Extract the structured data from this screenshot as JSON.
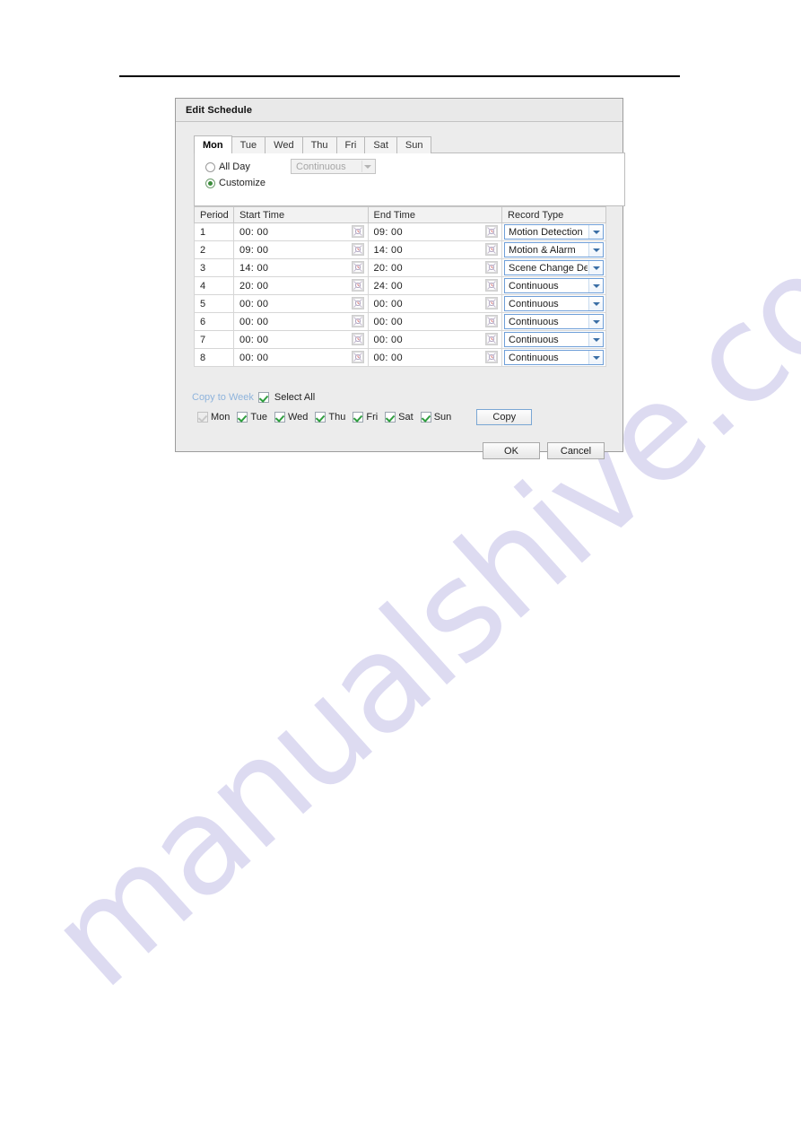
{
  "dialog": {
    "title": "Edit Schedule",
    "ok_label": "OK",
    "cancel_label": "Cancel"
  },
  "tabs": [
    {
      "label": "Mon",
      "active": true
    },
    {
      "label": "Tue",
      "active": false
    },
    {
      "label": "Wed",
      "active": false
    },
    {
      "label": "Thu",
      "active": false
    },
    {
      "label": "Fri",
      "active": false
    },
    {
      "label": "Sat",
      "active": false
    },
    {
      "label": "Sun",
      "active": false
    }
  ],
  "mode": {
    "all_day_label": "All Day",
    "all_day_selected": false,
    "customize_label": "Customize",
    "customize_selected": true,
    "all_day_record_type": "Continuous",
    "all_day_select_disabled": true
  },
  "table": {
    "headers": [
      "Period",
      "Start Time",
      "End Time",
      "Record Type"
    ],
    "rows": [
      {
        "period": "1",
        "start": "00: 00",
        "end": "09: 00",
        "type": "Motion Detection"
      },
      {
        "period": "2",
        "start": "09: 00",
        "end": "14: 00",
        "type": "Motion & Alarm"
      },
      {
        "period": "3",
        "start": "14: 00",
        "end": "20: 00",
        "type": "Scene Change Detection"
      },
      {
        "period": "4",
        "start": "20: 00",
        "end": "24: 00",
        "type": "Continuous"
      },
      {
        "period": "5",
        "start": "00: 00",
        "end": "00: 00",
        "type": "Continuous"
      },
      {
        "period": "6",
        "start": "00: 00",
        "end": "00: 00",
        "type": "Continuous"
      },
      {
        "period": "7",
        "start": "00: 00",
        "end": "00: 00",
        "type": "Continuous"
      },
      {
        "period": "8",
        "start": "00: 00",
        "end": "00: 00",
        "type": "Continuous"
      }
    ]
  },
  "copy": {
    "link_label": "Copy to Week",
    "select_all_label": "Select All",
    "select_all_checked": true,
    "copy_button_label": "Copy",
    "days": [
      {
        "label": "Mon",
        "checked": true,
        "disabled": true
      },
      {
        "label": "Tue",
        "checked": true,
        "disabled": false
      },
      {
        "label": "Wed",
        "checked": true,
        "disabled": false
      },
      {
        "label": "Thu",
        "checked": true,
        "disabled": false
      },
      {
        "label": "Fri",
        "checked": true,
        "disabled": false
      },
      {
        "label": "Sat",
        "checked": true,
        "disabled": false
      },
      {
        "label": "Sun",
        "checked": true,
        "disabled": false
      }
    ]
  },
  "watermark": {
    "text": "manualshive.com"
  },
  "colors": {
    "dialog_bg": "#ececec",
    "titlebar_bg": "#e9e9e9",
    "link_blue": "#8fb4dc",
    "select_border_blue": "#6f9fd8",
    "check_green": "#2f9e3f",
    "watermark": "#c9c6ea"
  }
}
